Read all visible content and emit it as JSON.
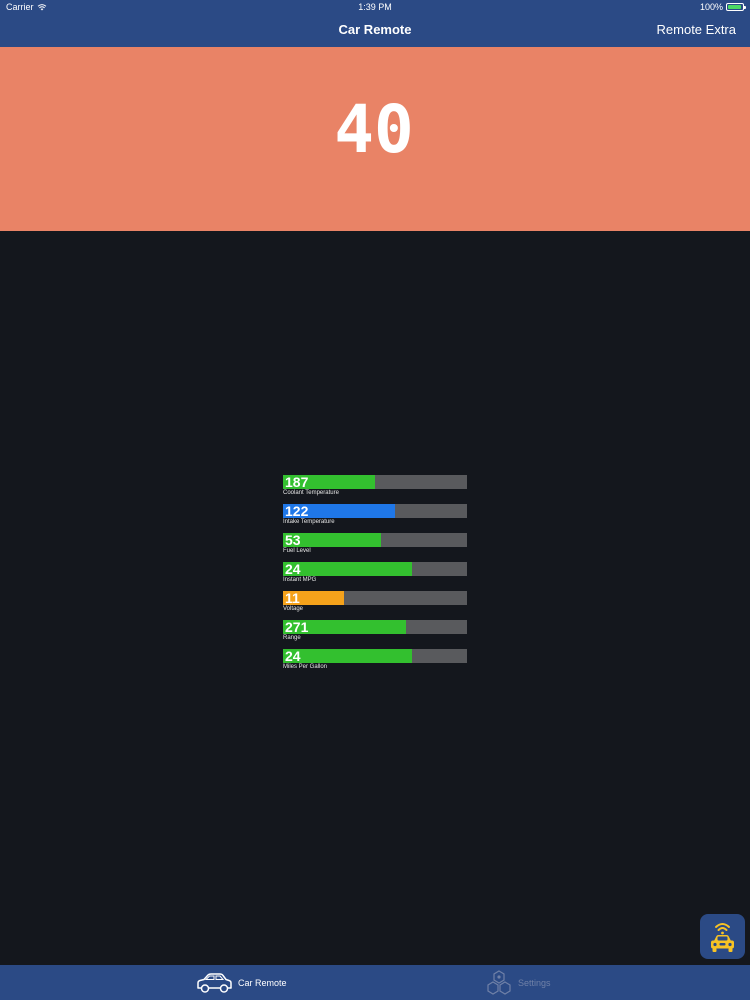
{
  "status_bar": {
    "carrier": "Carrier",
    "time": "1:39 PM",
    "battery": "100%",
    "icons": {
      "wifi": "wifi-icon",
      "battery": "battery-icon"
    }
  },
  "nav": {
    "title": "Car Remote",
    "action_label": "Remote Extra"
  },
  "speed": {
    "value": "40"
  },
  "gauges": [
    {
      "value": "187",
      "label": "Coolant Temperature",
      "fill": 0.5,
      "color": "#33c02f"
    },
    {
      "value": "122",
      "label": "Intake Temperature",
      "fill": 0.61,
      "color": "#1f77e8"
    },
    {
      "value": "53",
      "label": "Fuel Level",
      "fill": 0.53,
      "color": "#33c02f"
    },
    {
      "value": "24",
      "label": "Instant MPG",
      "fill": 0.7,
      "color": "#33c02f"
    },
    {
      "value": "11",
      "label": "Voltage",
      "fill": 0.33,
      "color": "#f5a21b"
    },
    {
      "value": "271",
      "label": "Range",
      "fill": 0.67,
      "color": "#33c02f"
    },
    {
      "value": "24",
      "label": "Miles Per Gallon",
      "fill": 0.7,
      "color": "#33c02f"
    }
  ],
  "tabs": [
    {
      "label": "Car Remote",
      "icon": "car-icon",
      "active": true
    },
    {
      "label": "Settings",
      "icon": "hexagons-icon",
      "active": false
    }
  ],
  "floating_button": {
    "icon": "remote-car-icon"
  },
  "colors": {
    "bar_blue": "#2b4a85",
    "banner": "#e98366",
    "background": "#14171d",
    "track": "#595a5d",
    "accent_yellow": "#f7c325"
  }
}
